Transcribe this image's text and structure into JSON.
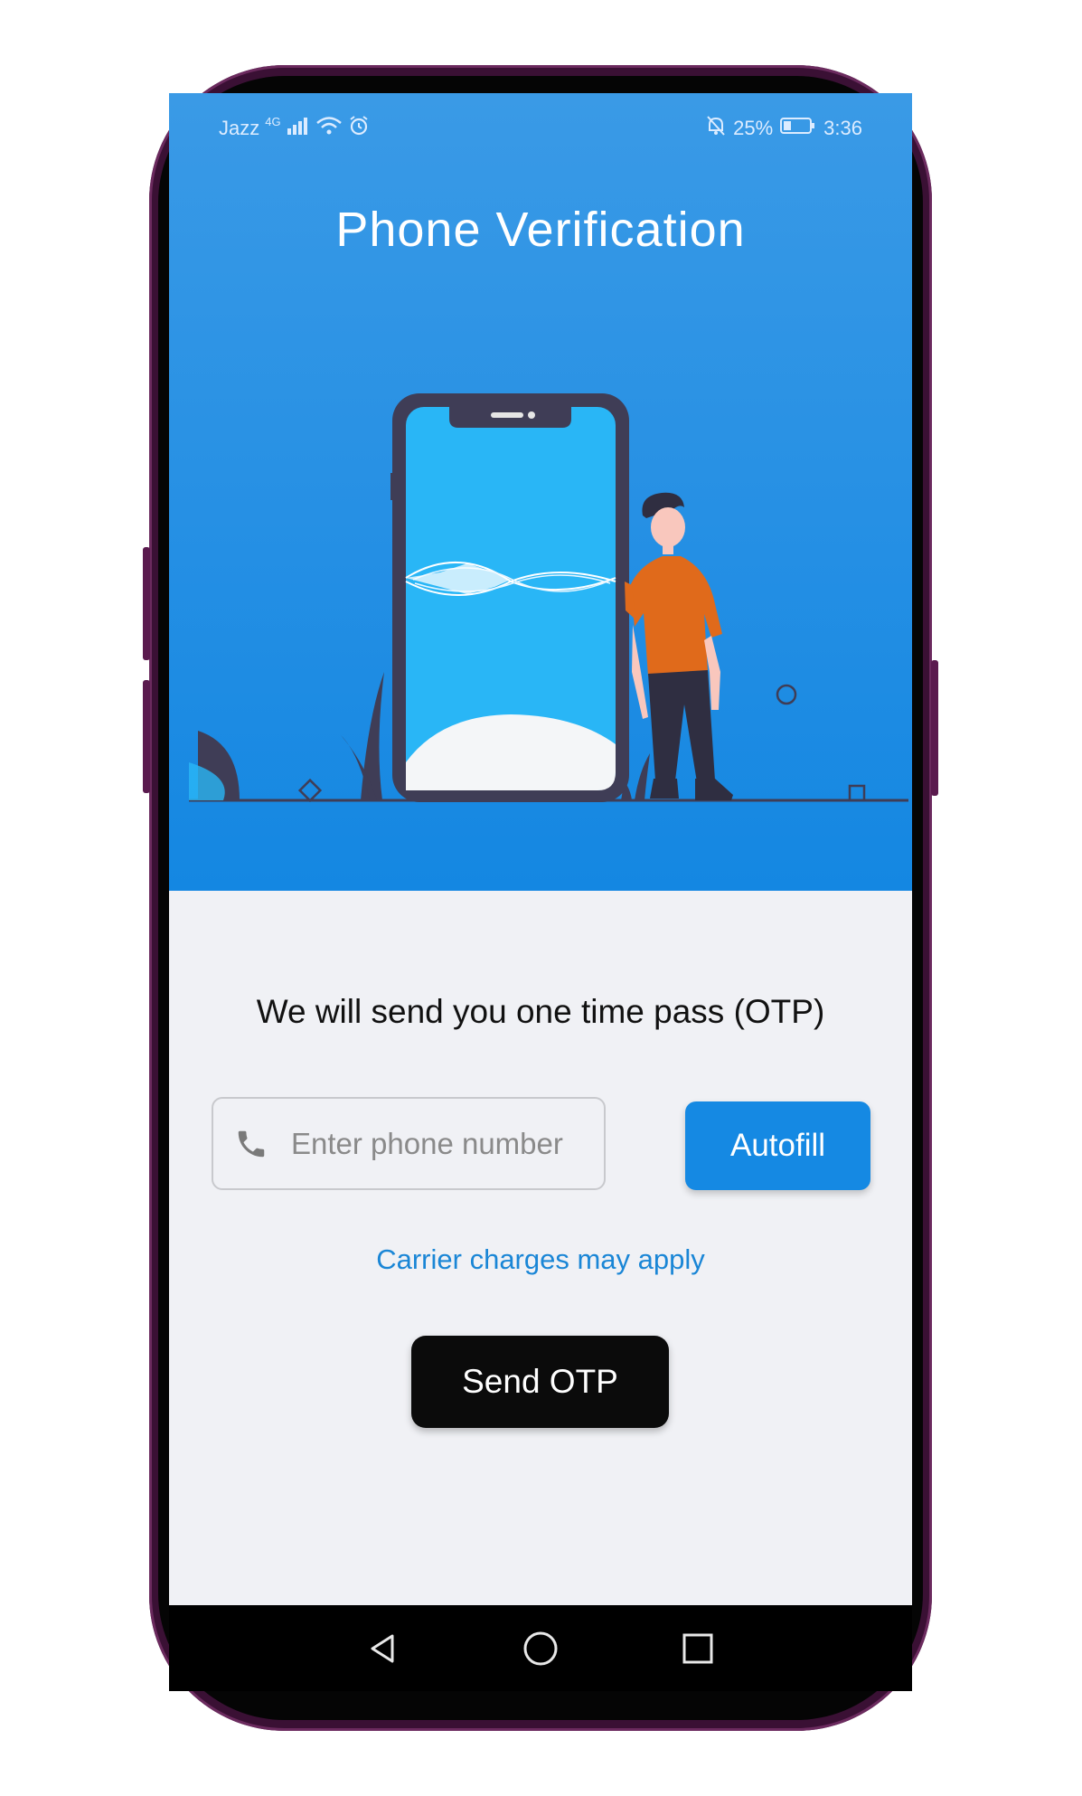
{
  "status_bar": {
    "carrier": "Jazz",
    "network": "4G",
    "battery": "25%",
    "time": "3:36",
    "icons": [
      "signal-icon",
      "wifi-icon",
      "alarm-icon",
      "mute-icon",
      "battery-icon"
    ]
  },
  "header": {
    "title": "Phone Verification"
  },
  "main": {
    "otp_message": "We will send you one time pass (OTP)",
    "phone_placeholder": "Enter phone number",
    "phone_value": "",
    "autofill_label": "Autofill",
    "carrier_note": "Carrier charges may apply",
    "send_label": "Send OTP"
  },
  "nav": {
    "icons": [
      "back-icon",
      "home-icon",
      "recents-icon"
    ]
  },
  "colors": {
    "hero_blue": "#1487e2",
    "accent": "#1589e3",
    "link": "#1a86d6",
    "send_button": "#0b0b0b",
    "background": "#f0f1f5",
    "person_shirt": "#e06a1b"
  }
}
